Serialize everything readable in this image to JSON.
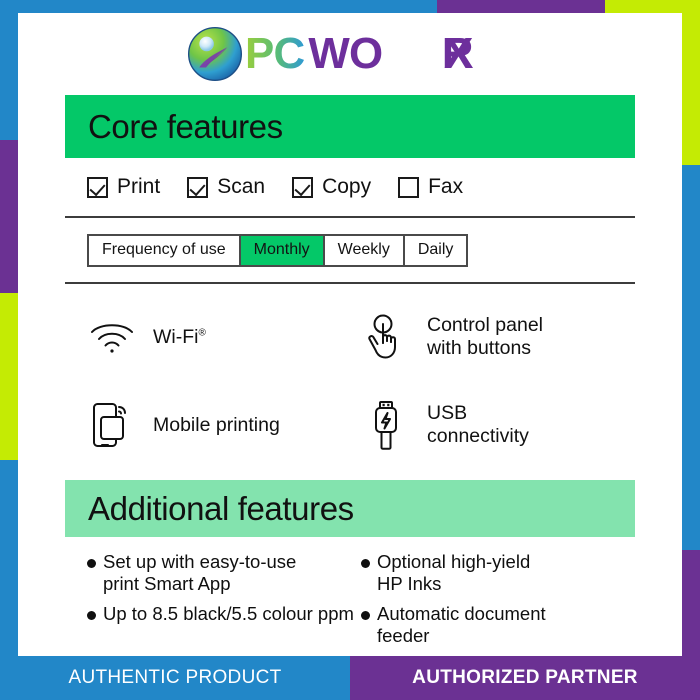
{
  "brand": {
    "logo_text": "PCWORX",
    "logo_icon": "globe-swoosh-icon",
    "colors": {
      "pc_gradient_start": "#8dc63f",
      "pc_gradient_end": "#2a9fd6",
      "worx": "#6d2f9c"
    }
  },
  "edge_strips": {
    "blue": "#2287c8",
    "purple": "#6b3193",
    "lime": "#c4eb04"
  },
  "core": {
    "title": "Core features",
    "header_color": "#04c868",
    "checkboxes": [
      {
        "label": "Print",
        "checked": true
      },
      {
        "label": "Scan",
        "checked": true
      },
      {
        "label": "Copy",
        "checked": true
      },
      {
        "label": "Fax",
        "checked": false
      }
    ],
    "frequency": {
      "label": "Frequency of use",
      "options": [
        "Monthly",
        "Weekly",
        "Daily"
      ],
      "selected": "Monthly",
      "selected_color": "#04c868"
    },
    "icon_features": [
      {
        "icon": "wifi-icon",
        "line1": "Wi-Fi",
        "sup": "®",
        "line2": ""
      },
      {
        "icon": "hand-tap-icon",
        "line1": "Control panel",
        "sup": "",
        "line2": "with buttons"
      },
      {
        "icon": "mobile-print-icon",
        "line1": "Mobile printing",
        "sup": "",
        "line2": ""
      },
      {
        "icon": "usb-plug-icon",
        "line1": "USB",
        "sup": "",
        "line2": "connectivity"
      }
    ]
  },
  "additional": {
    "title": "Additional features",
    "header_color": "#83e3ae",
    "bullets": [
      {
        "line1": "Set up with easy-to-use",
        "line2": "print Smart App"
      },
      {
        "line1": "Optional high-yield",
        "line2": "HP Inks"
      },
      {
        "line1": "Up to 8.5 black/5.5 colour ppm",
        "line2": ""
      },
      {
        "line1": "Automatic document",
        "line2": "feeder"
      }
    ]
  },
  "footer": {
    "authentic_label": "AUTHENTIC PRODUCT",
    "authentic_color": "#2287c8",
    "authorized_label": "AUTHORIZED PARTNER",
    "authorized_color": "#6b3193"
  }
}
